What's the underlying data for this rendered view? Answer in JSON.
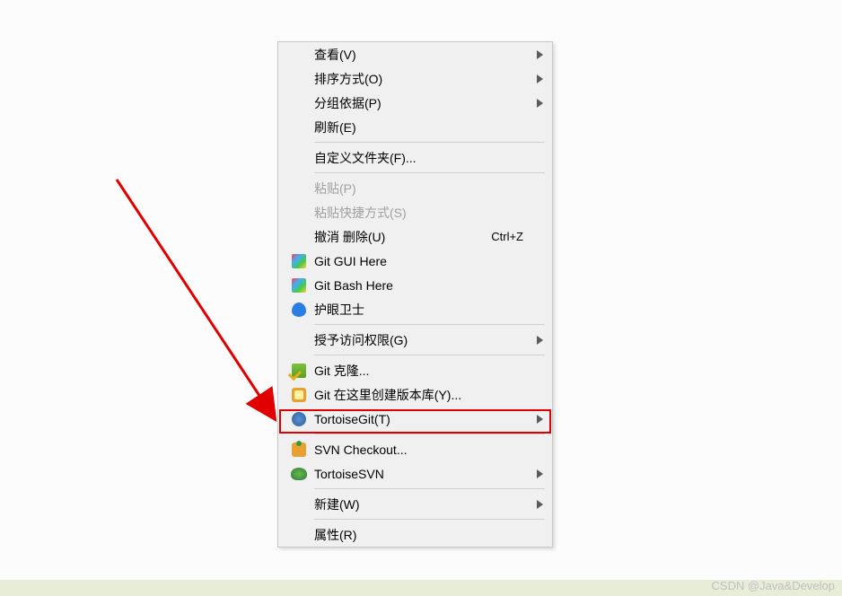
{
  "watermark": "CSDN @Java&Develop",
  "menu": {
    "view": {
      "label": "查看(V)",
      "submenu": true
    },
    "sort": {
      "label": "排序方式(O)",
      "submenu": true
    },
    "group": {
      "label": "分组依据(P)",
      "submenu": true
    },
    "refresh": {
      "label": "刷新(E)"
    },
    "customize": {
      "label": "自定义文件夹(F)..."
    },
    "paste": {
      "label": "粘贴(P)",
      "disabled": true
    },
    "paste_shortcut": {
      "label": "粘贴快捷方式(S)",
      "disabled": true
    },
    "undo_delete": {
      "label": "撤消 删除(U)",
      "shortcut": "Ctrl+Z"
    },
    "git_gui": {
      "label": "Git GUI Here"
    },
    "git_bash": {
      "label": "Git Bash Here"
    },
    "eye_guard": {
      "label": "护眼卫士"
    },
    "grant_access": {
      "label": "授予访问权限(G)",
      "submenu": true
    },
    "git_clone": {
      "label": "Git 克隆..."
    },
    "git_create": {
      "label": "Git 在这里创建版本库(Y)..."
    },
    "tortoise_git": {
      "label": "TortoiseGit(T)",
      "submenu": true
    },
    "svn_checkout": {
      "label": "SVN Checkout..."
    },
    "tortoise_svn": {
      "label": "TortoiseSVN",
      "submenu": true
    },
    "new": {
      "label": "新建(W)",
      "submenu": true
    },
    "properties": {
      "label": "属性(R)"
    }
  }
}
